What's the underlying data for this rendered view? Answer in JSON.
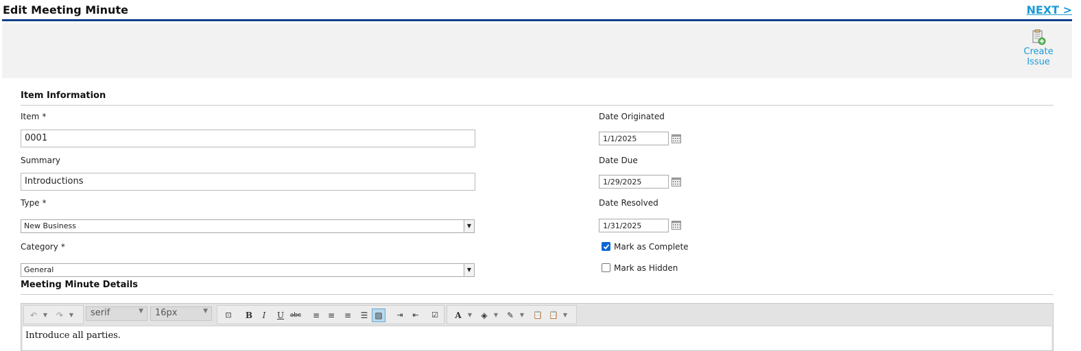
{
  "header": {
    "title": "Edit Meeting Minute",
    "next_label": "NEXT >"
  },
  "toolbar": {
    "create_issue_line1": "Create",
    "create_issue_line2": "Issue"
  },
  "item_information": {
    "section_title": "Item Information",
    "item": {
      "label": "Item",
      "required_mark": "*",
      "value": "0001"
    },
    "summary": {
      "label": "Summary",
      "value": "Introductions"
    },
    "type": {
      "label": "Type",
      "required_mark": "*",
      "value": "New Business"
    },
    "category": {
      "label": "Category",
      "required_mark": "*",
      "value": "General"
    },
    "date_originated": {
      "label": "Date Originated",
      "value": "1/1/2025"
    },
    "date_due": {
      "label": "Date Due",
      "value": "1/29/2025"
    },
    "date_resolved": {
      "label": "Date Resolved",
      "value": "1/31/2025"
    },
    "mark_complete": {
      "label": "Mark as Complete",
      "checked": true
    },
    "mark_hidden": {
      "label": "Mark as Hidden",
      "checked": false
    }
  },
  "details": {
    "section_title": "Meeting Minute Details",
    "editor": {
      "font_family": "serif",
      "font_size": "16px",
      "content": "Introduce all parties."
    }
  },
  "colors": {
    "accent": "#1a9ad6",
    "header_rule": "#0b3f8a",
    "checkbox_checked": "#0b66d6"
  }
}
